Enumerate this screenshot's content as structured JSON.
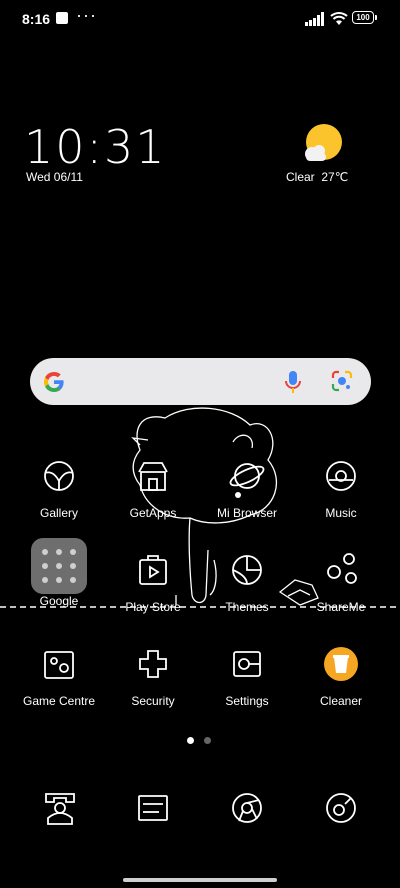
{
  "status": {
    "time": "8:16",
    "more": "···",
    "battery": "100"
  },
  "clock_widget": {
    "time": "10:31",
    "date": "Wed 06/11"
  },
  "weather": {
    "condition": "Clear",
    "temp": "27℃"
  },
  "apps": [
    {
      "label": "Gallery",
      "icon": "gallery-icon"
    },
    {
      "label": "GetApps",
      "icon": "getapps-icon"
    },
    {
      "label": "Mi Browser",
      "icon": "mi-browser-icon"
    },
    {
      "label": "Music",
      "icon": "music-icon"
    },
    {
      "label": "Google",
      "icon": "google-folder-icon"
    },
    {
      "label": "Play Store",
      "icon": "play-store-icon"
    },
    {
      "label": "Themes",
      "icon": "themes-icon"
    },
    {
      "label": "ShareMe",
      "icon": "shareme-icon"
    },
    {
      "label": "Game Centre",
      "icon": "game-centre-icon"
    },
    {
      "label": "Security",
      "icon": "security-icon"
    },
    {
      "label": "Settings",
      "icon": "settings-icon"
    },
    {
      "label": "Cleaner",
      "icon": "cleaner-icon"
    }
  ],
  "pages": {
    "count": 2,
    "current": 1
  },
  "dock": [
    "phone-icon",
    "messages-icon",
    "chrome-icon",
    "camera-icon"
  ],
  "colors": {
    "accent_orange": "#f5a623",
    "weather_sun": "#fbc42c"
  }
}
